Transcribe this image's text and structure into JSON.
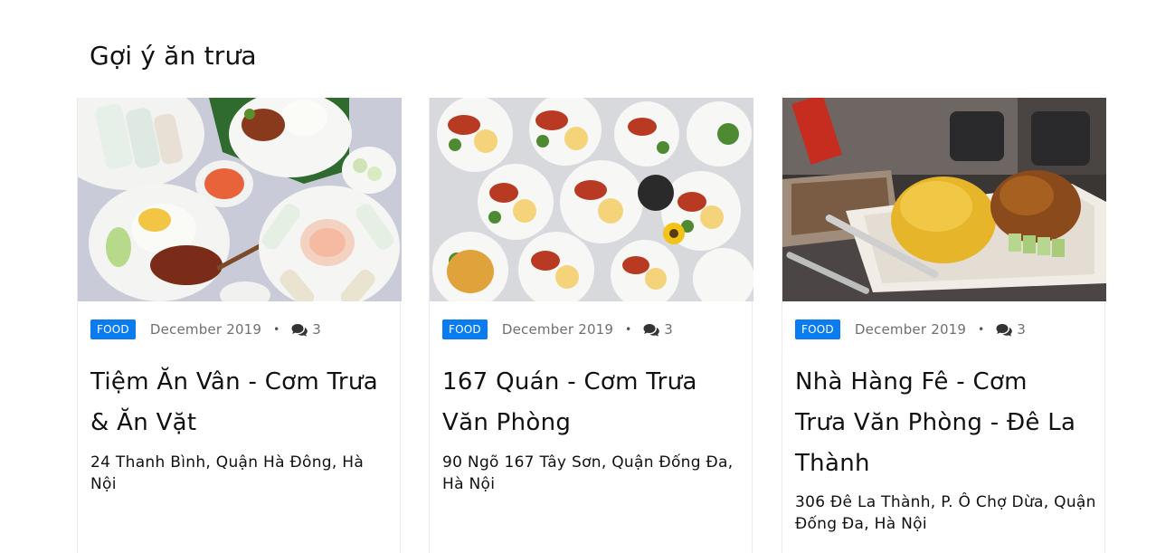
{
  "section": {
    "title": "Gợi ý ăn trưa"
  },
  "posts": [
    {
      "category": "FOOD",
      "date": "December 2019",
      "separator": "•",
      "comment_count": "3",
      "title": "Tiệm Ăn Vân - Cơm Trưa & Ăn Vặt",
      "address": "24 Thanh Bình, Quận Hà Đông, Hà Nội",
      "image_icon": "food-photo-rice-plate-spring-rolls"
    },
    {
      "category": "FOOD",
      "date": "December 2019",
      "separator": "•",
      "comment_count": "3",
      "title": "167 Quán - Cơm Trưa Văn Phòng",
      "address": "90 Ngõ 167 Tây Sơn, Quận Đống Đa, Hà Nội",
      "image_icon": "food-photo-many-rice-plates"
    },
    {
      "category": "FOOD",
      "date": "December 2019",
      "separator": "•",
      "comment_count": "3",
      "title": "Nhà Hàng Fê - Cơm Trưa Văn Phòng - Đê La Thành",
      "address": "306 Đê La Thành, P. Ô Chợ Dừa, Quận Đống Đa, Hà Nội",
      "image_icon": "food-photo-yellow-rice-restaurant"
    }
  ],
  "colors": {
    "tag_background": "#0a7cf0",
    "meta_text": "#707070"
  }
}
